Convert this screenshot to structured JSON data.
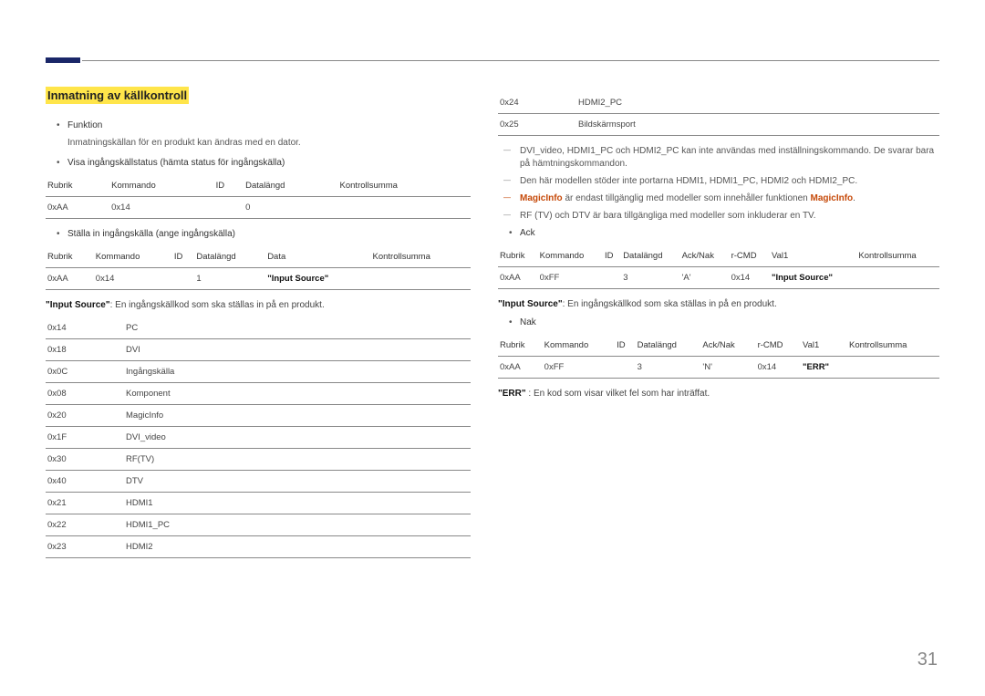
{
  "page_number": "31",
  "heading": "Inmatning av källkontroll",
  "left": {
    "funktion_label": "Funktion",
    "funktion_desc": "Inmatningskällan för en produkt kan ändras med en dator.",
    "visa_label": "Visa ingångskällstatus (hämta status för ingångskälla)",
    "table1": {
      "headers": [
        "Rubrik",
        "Kommando",
        "ID",
        "Datalängd",
        "Kontrollsumma"
      ],
      "row": [
        "0xAA",
        "0x14",
        "",
        "0",
        ""
      ]
    },
    "stalla_label": "Ställa in ingångskälla (ange ingångskälla)",
    "table2": {
      "headers": [
        "Rubrik",
        "Kommando",
        "ID",
        "Datalängd",
        "Data",
        "Kontrollsumma"
      ],
      "row": [
        "0xAA",
        "0x14",
        "",
        "1",
        "\"Input Source\"",
        ""
      ]
    },
    "input_source_desc_prefix": "\"Input Source\"",
    "input_source_desc": ": En ingångskällkod som ska ställas in på en produkt.",
    "codes": [
      {
        "code": "0x14",
        "label": "PC"
      },
      {
        "code": "0x18",
        "label": "DVI"
      },
      {
        "code": "0x0C",
        "label": "Ingångskälla"
      },
      {
        "code": "0x08",
        "label": "Komponent"
      },
      {
        "code": "0x20",
        "label": "MagicInfo"
      },
      {
        "code": "0x1F",
        "label": "DVI_video"
      },
      {
        "code": "0x30",
        "label": "RF(TV)"
      },
      {
        "code": "0x40",
        "label": "DTV"
      },
      {
        "code": "0x21",
        "label": "HDMI1"
      },
      {
        "code": "0x22",
        "label": "HDMI1_PC"
      },
      {
        "code": "0x23",
        "label": "HDMI2"
      }
    ]
  },
  "right": {
    "codes_cont": [
      {
        "code": "0x24",
        "label": "HDMI2_PC"
      },
      {
        "code": "0x25",
        "label": "Bildskärmsport"
      }
    ],
    "note1": "DVI_video, HDMI1_PC och HDMI2_PC kan inte användas med inställningskommando. De svarar bara på hämtningskommandon.",
    "note2": "Den här modellen stöder inte portarna HDMI1, HDMI1_PC, HDMI2 och HDMI2_PC.",
    "note3_pre": "MagicInfo",
    "note3_mid": " är endast tillgänglig med modeller som innehåller funktionen ",
    "note3_post": "MagicInfo",
    "note3_end": ".",
    "note4": "RF (TV) och DTV är bara tillgängliga med modeller som inkluderar en TV.",
    "ack_label": "Ack",
    "table_ack": {
      "headers": [
        "Rubrik",
        "Kommando",
        "ID",
        "Datalängd",
        "Ack/Nak",
        "r-CMD",
        "Val1",
        "Kontrollsumma"
      ],
      "row": [
        "0xAA",
        "0xFF",
        "",
        "3",
        "'A'",
        "0x14",
        "\"Input Source\"",
        ""
      ]
    },
    "input_source_desc_prefix": "\"Input Source\"",
    "input_source_desc": ": En ingångskällkod som ska ställas in på en produkt.",
    "nak_label": "Nak",
    "table_nak": {
      "headers": [
        "Rubrik",
        "Kommando",
        "ID",
        "Datalängd",
        "Ack/Nak",
        "r-CMD",
        "Val1",
        "Kontrollsumma"
      ],
      "row": [
        "0xAA",
        "0xFF",
        "",
        "3",
        "'N'",
        "0x14",
        "\"ERR\"",
        ""
      ]
    },
    "err_prefix": "\"ERR\"",
    "err_desc": " : En kod som visar vilket fel som har inträffat."
  }
}
